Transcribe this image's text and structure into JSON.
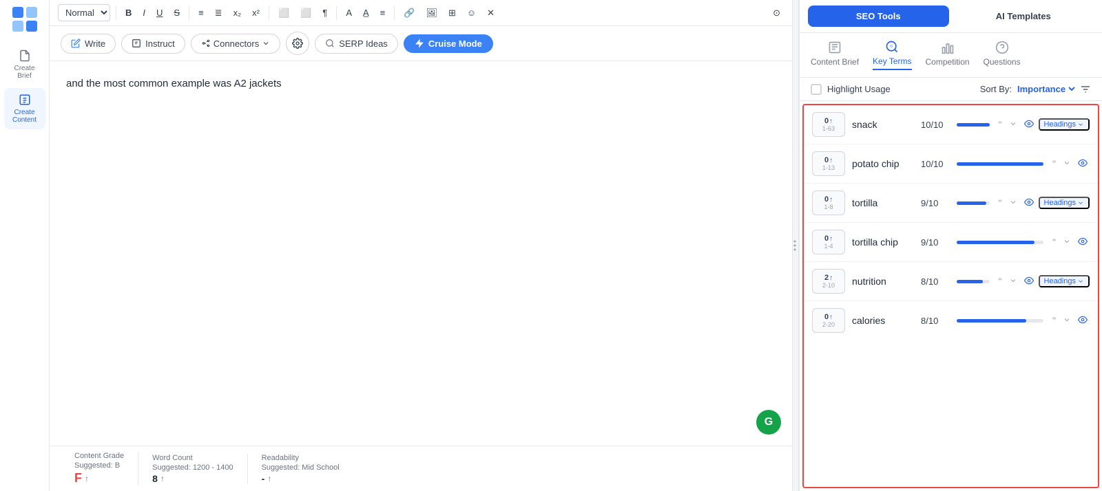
{
  "sidebar": {
    "items": [
      {
        "label": "Create Brief",
        "icon": "file-icon",
        "active": false
      },
      {
        "label": "Create Content",
        "icon": "edit-icon",
        "active": true
      }
    ]
  },
  "toolbar": {
    "format_select": "Normal",
    "buttons": [
      "B",
      "I",
      "U",
      "S",
      "OL",
      "UL",
      "Sub",
      "Sup",
      "AlignL",
      "AlignR",
      "Para",
      "A",
      "Aa",
      "Align",
      "Link",
      "Img",
      "Table",
      "Emoji",
      "Clear"
    ]
  },
  "action_bar": {
    "write_label": "Write",
    "instruct_label": "Instruct",
    "connectors_label": "Connectors",
    "serp_ideas_label": "SERP Ideas",
    "cruise_mode_label": "Cruise Mode"
  },
  "editor": {
    "content": "and the most common example was A2 jackets"
  },
  "bottom_bar": {
    "content_grade_label": "Content Grade",
    "content_grade_sub": "Suggested: B",
    "content_grade_value": "F",
    "word_count_label": "Word Count",
    "word_count_sub": "Suggested: 1200 - 1400",
    "word_count_value": "8",
    "readability_label": "Readability",
    "readability_sub": "Suggested: Mid School",
    "readability_value": "-"
  },
  "right_panel": {
    "seo_tools_label": "SEO Tools",
    "ai_templates_label": "AI Templates",
    "sub_tabs": [
      {
        "label": "Content Brief",
        "icon": "brief-icon",
        "active": false
      },
      {
        "label": "Key Terms",
        "icon": "key-icon",
        "active": true
      },
      {
        "label": "Competition",
        "icon": "bar-icon",
        "active": false
      },
      {
        "label": "Questions",
        "icon": "question-icon",
        "active": false
      }
    ],
    "highlight_usage_label": "Highlight Usage",
    "sort_by_label": "Sort By:",
    "sort_value": "Importance",
    "terms": [
      {
        "id": 1,
        "count": "0",
        "arrow": "↑",
        "range": "1-63",
        "name": "snack",
        "score": "10/10",
        "bar_pct": 100,
        "has_headings": true
      },
      {
        "id": 2,
        "count": "0",
        "arrow": "↑",
        "range": "1-13",
        "name": "potato chip",
        "score": "10/10",
        "bar_pct": 100,
        "has_headings": false
      },
      {
        "id": 3,
        "count": "0",
        "arrow": "↑",
        "range": "1-8",
        "name": "tortilla",
        "score": "9/10",
        "bar_pct": 90,
        "has_headings": true
      },
      {
        "id": 4,
        "count": "0",
        "arrow": "↑",
        "range": "1-4",
        "name": "tortilla chip",
        "score": "9/10",
        "bar_pct": 90,
        "has_headings": false
      },
      {
        "id": 5,
        "count": "2",
        "arrow": "↑",
        "range": "2-10",
        "name": "nutrition",
        "score": "8/10",
        "bar_pct": 80,
        "has_headings": true
      },
      {
        "id": 6,
        "count": "0",
        "arrow": "↑",
        "range": "2-20",
        "name": "calories",
        "score": "8/10",
        "bar_pct": 80,
        "has_headings": false
      }
    ],
    "headings_label": "Headings"
  }
}
